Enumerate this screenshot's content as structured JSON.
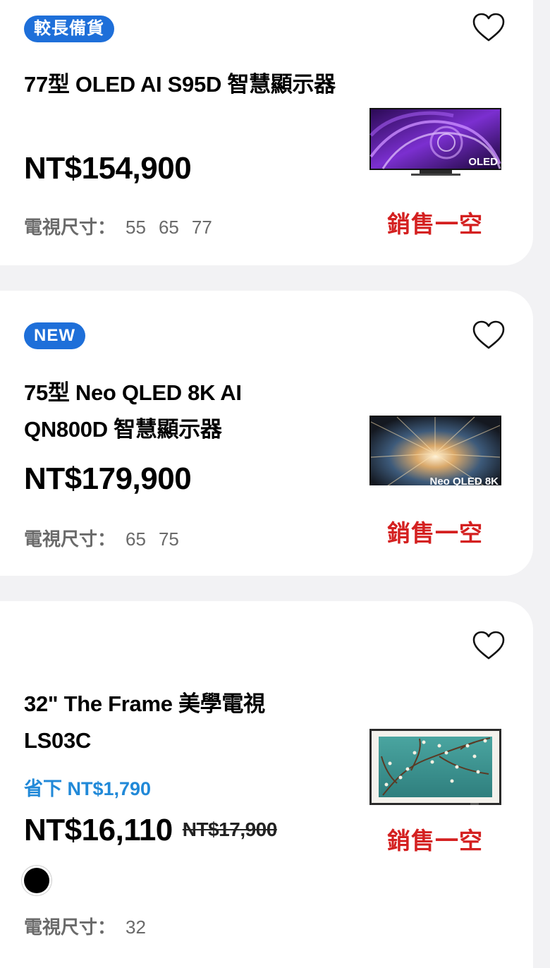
{
  "products": [
    {
      "badge": "較長備貨",
      "title": "77型 OLED AI S95D 智慧顯示器",
      "price": "NT$154,900",
      "size_label": "電視尺寸：",
      "sizes": [
        "55",
        "65",
        "77"
      ],
      "status": "銷售一空",
      "tv_logo": "OLED"
    },
    {
      "badge": "NEW",
      "title": "75型 Neo QLED 8K AI QN800D 智慧顯示器",
      "price": "NT$179,900",
      "size_label": "電視尺寸：",
      "sizes": [
        "65",
        "75"
      ],
      "status": "銷售一空",
      "tv_logo": "Neo QLED 8K"
    },
    {
      "title": "32\" The Frame 美學電視 LS03C",
      "savings": "省下 NT$1,790",
      "price": "NT$16,110",
      "original_price": "NT$17,900",
      "color_swatch": "#000000",
      "size_label": "電視尺寸：",
      "sizes": [
        "32"
      ],
      "status": "銷售一空"
    }
  ],
  "colors": {
    "badge_blue": "#1e6fd9",
    "savings_blue": "#2189d8",
    "soldout_red": "#d42020",
    "size_gray": "#6a6a6a"
  },
  "icons": {
    "wishlist": "heart-outline-icon"
  }
}
